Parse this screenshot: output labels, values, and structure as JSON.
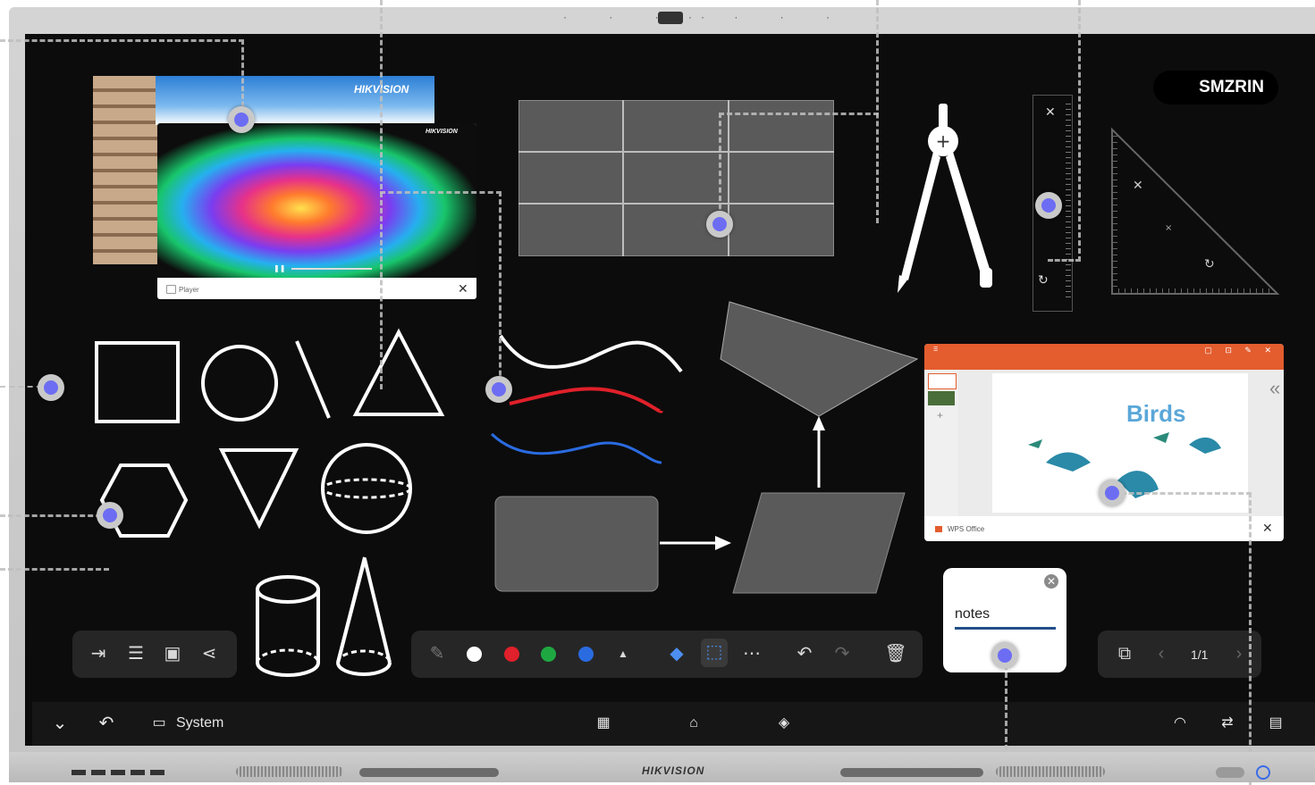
{
  "device": {
    "brand_bottom": "HIKVISION",
    "photo_brand": "HIKVISION",
    "video_brand": "HIKVISION"
  },
  "badge": {
    "label": "SMZRIN"
  },
  "player": {
    "label": "Player"
  },
  "wps": {
    "slide_title": "Birds",
    "footer_label": "WPS Office"
  },
  "notes": {
    "text": "notes"
  },
  "left_toolbar": {
    "icons": [
      "exit-icon",
      "menu-icon",
      "save-icon",
      "share-icon"
    ]
  },
  "pen_toolbar": {
    "colors": [
      "#ffffff",
      "#e0202a",
      "#1fa842",
      "#2a6be0"
    ],
    "icons": [
      "pen-icon",
      "color-white",
      "color-red",
      "color-green",
      "color-blue",
      "expand-icon",
      "eraser-icon",
      "lasso-icon",
      "more-icon",
      "undo-icon",
      "redo-icon",
      "delete-icon"
    ]
  },
  "page_toolbar": {
    "page_indicator": "1/1"
  },
  "taskbar": {
    "system_label": "System",
    "icons": [
      "collapse-icon",
      "back-icon",
      "system-icon",
      "apps-icon",
      "home-icon",
      "layers-icon",
      "wifi-icon",
      "settings-icon",
      "toolbox-icon"
    ]
  },
  "colors": {
    "screen_bg": "#0c0c0c",
    "accent_marker": "#6d6df3",
    "wps_orange": "#e35d2f",
    "stroke_red": "#e0202a",
    "stroke_blue": "#2a6be0"
  }
}
